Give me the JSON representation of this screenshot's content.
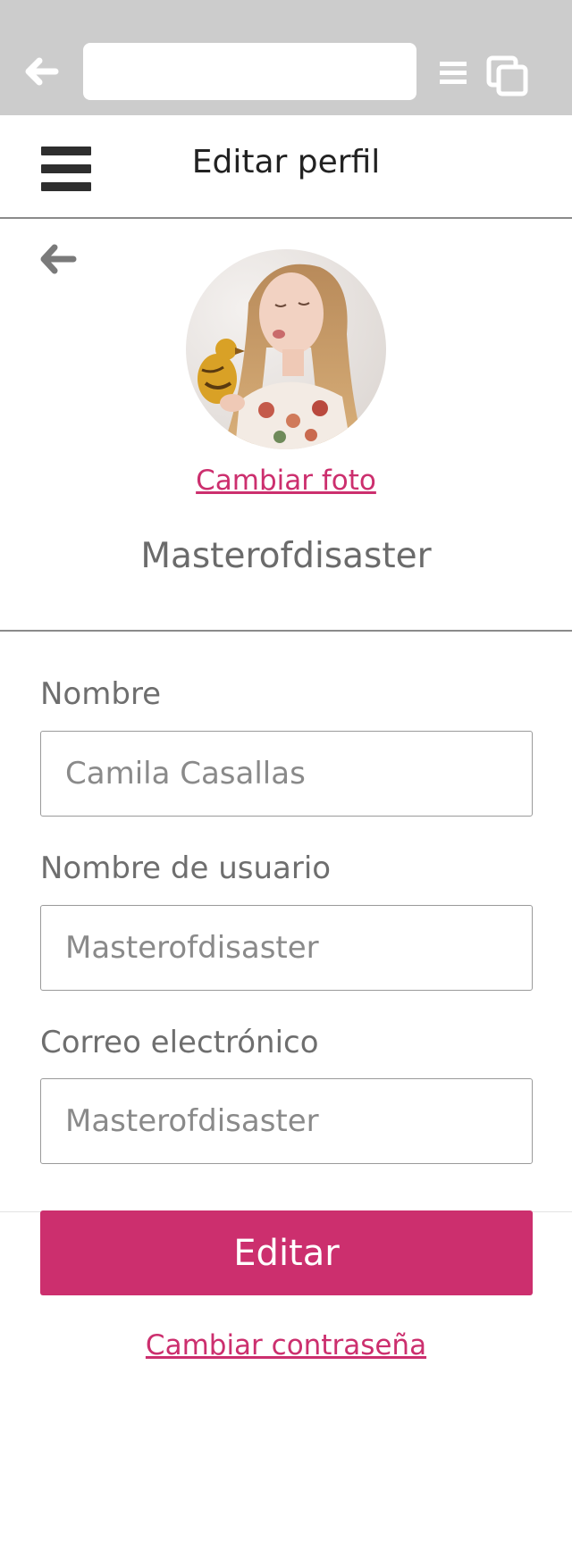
{
  "browser": {
    "back_icon": "arrow-left-icon",
    "url": "",
    "menu_icon": "menu-lines-icon",
    "tabs_icon": "tabs-icon"
  },
  "header": {
    "title": "Editar perfil",
    "menu_icon": "hamburger-icon"
  },
  "profile": {
    "back_icon": "arrow-left-icon",
    "change_photo_label": "Cambiar foto",
    "username": "Masterofdisaster"
  },
  "form": {
    "name": {
      "label": "Nombre",
      "value": "Camila Casallas"
    },
    "username": {
      "label": "Nombre de usuario",
      "value": "Masterofdisaster"
    },
    "email": {
      "label": "Correo electrónico",
      "value": "Masterofdisaster"
    },
    "submit_label": "Editar",
    "change_password_label": "Cambiar contraseña"
  },
  "colors": {
    "accent": "#cc2f6e",
    "chrome": "#cccccc",
    "text_dark": "#222222",
    "text_muted": "#6e6e6e"
  }
}
